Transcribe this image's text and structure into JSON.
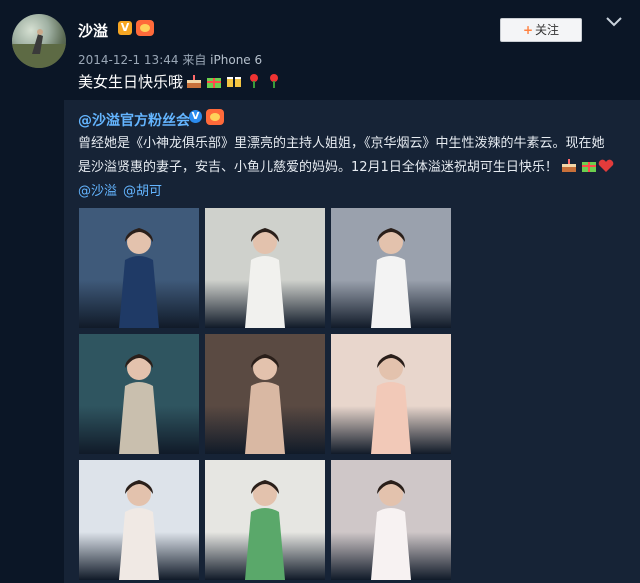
{
  "post": {
    "user_name": "沙溢",
    "timestamp": "2014-12-1 13:44",
    "source_prefix": "来自",
    "source": "iPhone 6",
    "follow_label": "关注",
    "follow_plus": "+",
    "text": "美女生日快乐哦"
  },
  "repost": {
    "original_user": "@沙溢官方粉丝会",
    "line1": "曾经她是《小神龙俱乐部》里漂亮的主持人姐姐，《京华烟云》中生性泼辣的牛素云。现在她",
    "line2": "是沙溢贤惠的妻子，安吉、小鱼儿慈爱的妈妈。12月1日全体溢迷祝胡可生日快乐！",
    "mentions": [
      "@沙溢",
      "@胡可"
    ]
  },
  "photos": [
    {
      "name": "photo-blue-dress",
      "bg": "#3f5a7a",
      "figure": "#1f3a66"
    },
    {
      "name": "photo-white-dress",
      "bg": "#cfd1cc",
      "figure": "#f1f1ee"
    },
    {
      "name": "photo-purple-hair",
      "bg": "#9aa1ad",
      "figure": "#f3f3f3"
    },
    {
      "name": "photo-lace-dress",
      "bg": "#2f5560",
      "figure": "#c9bfae"
    },
    {
      "name": "photo-with-baby-1",
      "bg": "#5a4a42",
      "figure": "#d9b8a3"
    },
    {
      "name": "photo-with-baby-2",
      "bg": "#e8d6cc",
      "figure": "#f2c9b8"
    },
    {
      "name": "photo-couple-kiss",
      "bg": "#dde3ea",
      "figure": "#f0e9e4"
    },
    {
      "name": "photo-green-cardigan",
      "bg": "#e6e6e2",
      "figure": "#5aa86a"
    },
    {
      "name": "photo-couple-dance",
      "bg": "#cfc7c8",
      "figure": "#f7f2f2"
    }
  ]
}
